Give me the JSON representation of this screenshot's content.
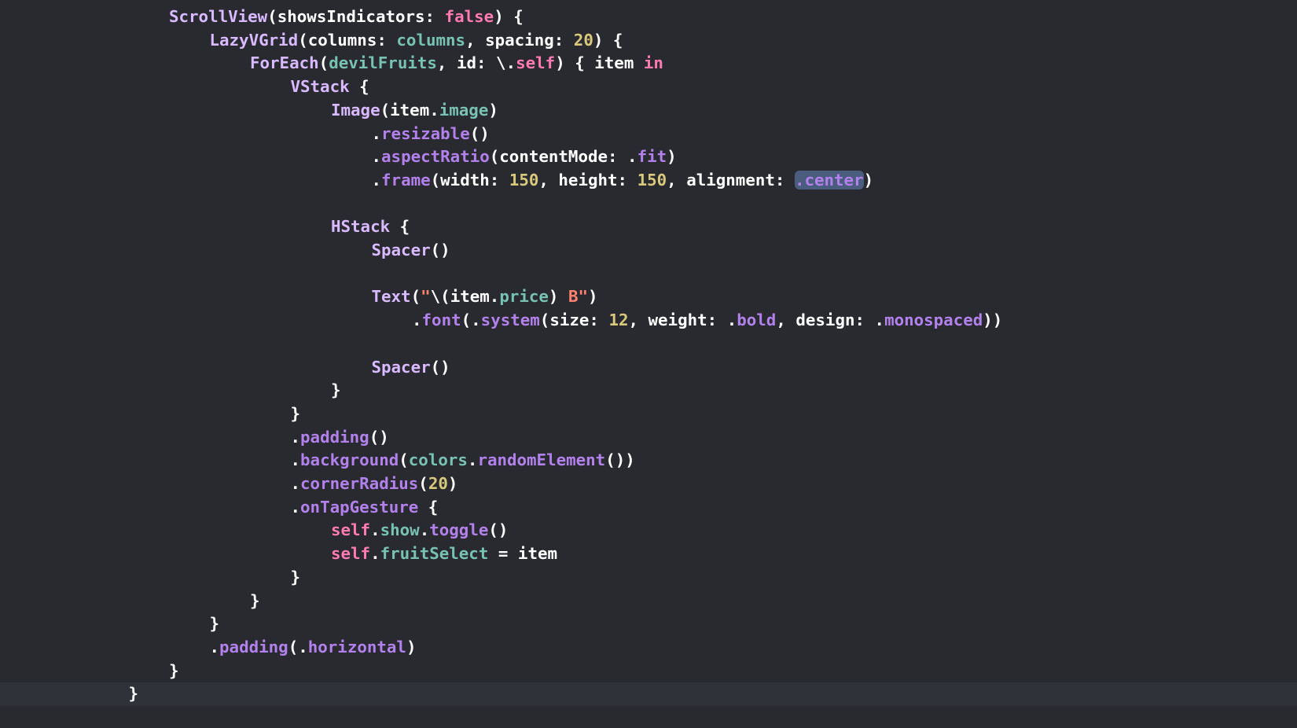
{
  "colors": {
    "background": "#292a30",
    "current_line": "#2f3239",
    "plain": "#ffffff",
    "keyword": "#ff7ab2",
    "type": "#dabaff",
    "method": "#b281eb",
    "property": "#78c2b3",
    "number": "#d9c97c",
    "string": "#ff8170",
    "selection": "#4b5d7e"
  },
  "lines": [
    {
      "indent": 2,
      "tokens": [
        [
          "type",
          "ScrollView"
        ],
        [
          "plain",
          "(showsIndicators: "
        ],
        [
          "keyword",
          "false"
        ],
        [
          "plain",
          ") {"
        ]
      ]
    },
    {
      "indent": 3,
      "tokens": [
        [
          "type",
          "LazyVGrid"
        ],
        [
          "plain",
          "(columns: "
        ],
        [
          "prop",
          "columns"
        ],
        [
          "plain",
          ", spacing: "
        ],
        [
          "number",
          "20"
        ],
        [
          "plain",
          ") {"
        ]
      ]
    },
    {
      "indent": 4,
      "tokens": [
        [
          "type",
          "ForEach"
        ],
        [
          "plain",
          "("
        ],
        [
          "prop",
          "devilFruits"
        ],
        [
          "plain",
          ", id: \\."
        ],
        [
          "keyword",
          "self"
        ],
        [
          "plain",
          ") { item "
        ],
        [
          "keyword",
          "in"
        ]
      ]
    },
    {
      "indent": 5,
      "tokens": [
        [
          "type",
          "VStack"
        ],
        [
          "plain",
          " {"
        ]
      ]
    },
    {
      "indent": 6,
      "tokens": [
        [
          "type",
          "Image"
        ],
        [
          "plain",
          "(item."
        ],
        [
          "prop",
          "image"
        ],
        [
          "plain",
          ")"
        ]
      ]
    },
    {
      "indent": 7,
      "tokens": [
        [
          "plain",
          "."
        ],
        [
          "method",
          "resizable"
        ],
        [
          "plain",
          "()"
        ]
      ]
    },
    {
      "indent": 7,
      "tokens": [
        [
          "plain",
          "."
        ],
        [
          "method",
          "aspectRatio"
        ],
        [
          "plain",
          "(contentMode: ."
        ],
        [
          "method",
          "fit"
        ],
        [
          "plain",
          ")"
        ]
      ]
    },
    {
      "indent": 7,
      "tokens": [
        [
          "plain",
          "."
        ],
        [
          "method",
          "frame"
        ],
        [
          "plain",
          "(width: "
        ],
        [
          "number",
          "150"
        ],
        [
          "plain",
          ", height: "
        ],
        [
          "number",
          "150"
        ],
        [
          "plain",
          ", alignment: "
        ],
        [
          "selected",
          ".center"
        ],
        [
          "plain",
          ")"
        ]
      ]
    },
    {
      "indent": 0,
      "tokens": []
    },
    {
      "indent": 6,
      "tokens": [
        [
          "type",
          "HStack"
        ],
        [
          "plain",
          " {"
        ]
      ]
    },
    {
      "indent": 7,
      "tokens": [
        [
          "type",
          "Spacer"
        ],
        [
          "plain",
          "()"
        ]
      ]
    },
    {
      "indent": 0,
      "tokens": []
    },
    {
      "indent": 7,
      "tokens": [
        [
          "type",
          "Text"
        ],
        [
          "plain",
          "("
        ],
        [
          "string",
          "\""
        ],
        [
          "plain",
          "\\(item."
        ],
        [
          "prop",
          "price"
        ],
        [
          "plain",
          ") "
        ],
        [
          "string",
          "B\""
        ],
        [
          "plain",
          ")"
        ]
      ]
    },
    {
      "indent": 8,
      "tokens": [
        [
          "plain",
          "."
        ],
        [
          "method",
          "font"
        ],
        [
          "plain",
          "(."
        ],
        [
          "method",
          "system"
        ],
        [
          "plain",
          "(size: "
        ],
        [
          "number",
          "12"
        ],
        [
          "plain",
          ", weight: ."
        ],
        [
          "method",
          "bold"
        ],
        [
          "plain",
          ", design: ."
        ],
        [
          "method",
          "monospaced"
        ],
        [
          "plain",
          "))"
        ]
      ]
    },
    {
      "indent": 0,
      "tokens": []
    },
    {
      "indent": 7,
      "tokens": [
        [
          "type",
          "Spacer"
        ],
        [
          "plain",
          "()"
        ]
      ]
    },
    {
      "indent": 6,
      "tokens": [
        [
          "plain",
          "}"
        ]
      ]
    },
    {
      "indent": 5,
      "tokens": [
        [
          "plain",
          "}"
        ]
      ]
    },
    {
      "indent": 5,
      "tokens": [
        [
          "plain",
          "."
        ],
        [
          "method",
          "padding"
        ],
        [
          "plain",
          "()"
        ]
      ]
    },
    {
      "indent": 5,
      "tokens": [
        [
          "plain",
          "."
        ],
        [
          "method",
          "background"
        ],
        [
          "plain",
          "("
        ],
        [
          "prop",
          "colors"
        ],
        [
          "plain",
          "."
        ],
        [
          "method",
          "randomElement"
        ],
        [
          "plain",
          "())"
        ]
      ]
    },
    {
      "indent": 5,
      "tokens": [
        [
          "plain",
          "."
        ],
        [
          "method",
          "cornerRadius"
        ],
        [
          "plain",
          "("
        ],
        [
          "number",
          "20"
        ],
        [
          "plain",
          ")"
        ]
      ]
    },
    {
      "indent": 5,
      "tokens": [
        [
          "plain",
          "."
        ],
        [
          "method",
          "onTapGesture"
        ],
        [
          "plain",
          " {"
        ]
      ]
    },
    {
      "indent": 6,
      "tokens": [
        [
          "keyword",
          "self"
        ],
        [
          "plain",
          "."
        ],
        [
          "prop",
          "show"
        ],
        [
          "plain",
          "."
        ],
        [
          "method",
          "toggle"
        ],
        [
          "plain",
          "()"
        ]
      ]
    },
    {
      "indent": 6,
      "tokens": [
        [
          "keyword",
          "self"
        ],
        [
          "plain",
          "."
        ],
        [
          "prop",
          "fruitSelect"
        ],
        [
          "plain",
          " = item"
        ]
      ]
    },
    {
      "indent": 5,
      "tokens": [
        [
          "plain",
          "}"
        ]
      ]
    },
    {
      "indent": 4,
      "tokens": [
        [
          "plain",
          "}"
        ]
      ]
    },
    {
      "indent": 3,
      "tokens": [
        [
          "plain",
          "}"
        ]
      ]
    },
    {
      "indent": 3,
      "tokens": [
        [
          "plain",
          "."
        ],
        [
          "method",
          "padding"
        ],
        [
          "plain",
          "(."
        ],
        [
          "method",
          "horizontal"
        ],
        [
          "plain",
          ")"
        ]
      ]
    },
    {
      "indent": 2,
      "tokens": [
        [
          "plain",
          "}"
        ]
      ]
    },
    {
      "indent": 1,
      "tokens": [
        [
          "plain",
          "}"
        ]
      ],
      "current": true
    }
  ]
}
